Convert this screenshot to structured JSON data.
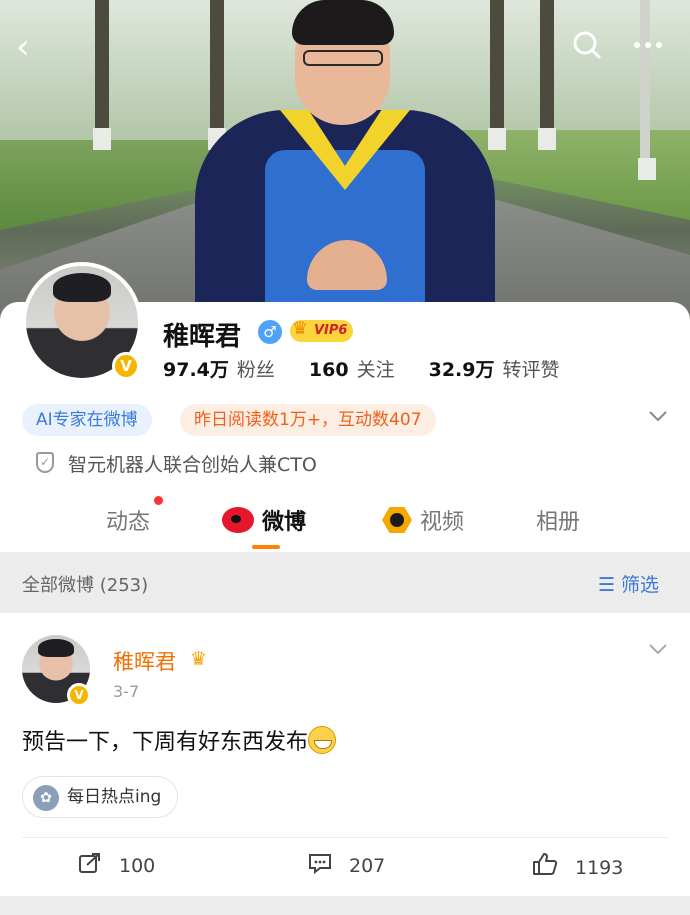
{
  "nav": {
    "back_icon": "back-chevron-icon",
    "search_icon": "search-icon",
    "more_icon": "more-dots-icon"
  },
  "profile": {
    "name": "稚晖君",
    "gender_symbol": "♂",
    "vip_label": "VIP6",
    "verified_badge": "V",
    "stats": [
      {
        "value": "97.4万",
        "label": "粉丝"
      },
      {
        "value": "160",
        "label": "关注"
      },
      {
        "value": "32.9万",
        "label": "转评赞"
      }
    ],
    "tag_ai": "AI专家在微博",
    "tag_reads": "昨日阅读数1万+，互动数407",
    "verification": "智元机器人联合创始人兼CTO"
  },
  "tabs": [
    {
      "label": "动态"
    },
    {
      "label": "微博"
    },
    {
      "label": "视频"
    },
    {
      "label": "相册"
    }
  ],
  "filter": {
    "all_label": "全部微博 (253)",
    "filter_label": "筛选"
  },
  "post": {
    "author": "稚晖君",
    "date": "3-7",
    "text": "预告一下，下周有好东西发布",
    "topic": "每日热点ing",
    "actions": {
      "reposts": "100",
      "comments": "207",
      "likes": "1193"
    }
  },
  "colors": {
    "accent": "#ff8200",
    "link_blue": "#3b7ad8",
    "weibo_red": "#e6162d",
    "verified_yellow": "#f7b500"
  }
}
